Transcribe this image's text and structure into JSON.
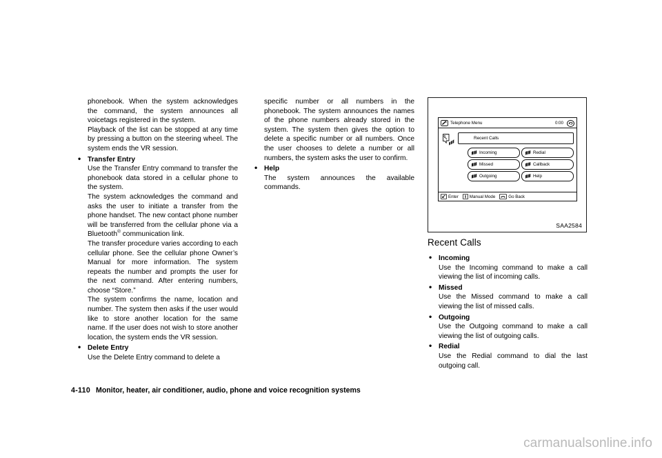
{
  "document": {
    "footer": {
      "page_number": "4-110",
      "chapter_title": "Monitor, heater, air conditioner, audio, phone and voice recognition systems"
    },
    "watermark": "carmanualsonline.info"
  },
  "column1": {
    "p1": "phonebook. When the system acknowledges the command, the system announces all voicetags registered in the system.",
    "p2": "Playback of the list can be stopped at any time by pressing a button on the steering wheel. The system ends the VR session.",
    "transfer_entry": {
      "heading": "Transfer Entry",
      "bullet": "•",
      "p1": "Use the Transfer Entry command to transfer the phonebook data stored in a cellular phone to the system.",
      "p2_before_sup": "The system acknowledges the command and asks the user to initiate a transfer from the phone handset. The new contact phone number will be transferred from the cellular phone via a Bluetooth",
      "p2_sup": "®",
      "p2_after_sup": " communication link.",
      "p3": "The transfer procedure varies according to each cellular phone. See the cellular phone Owner’s Manual for more information. The system repeats the number and prompts the user for the next command. After entering numbers, choose “Store.”",
      "p4": "The system confirms the name, location and number. The system then asks if the user would like to store another location for the same name. If the user does not wish to store another location, the system ends the VR session."
    },
    "delete_entry": {
      "heading": "Delete Entry",
      "bullet": "•",
      "p1": "Use the Delete Entry command to delete a"
    }
  },
  "column2": {
    "p1": "specific number or all numbers in the phonebook. The system announces the names of the phone numbers already stored in the system. The system then gives the option to delete a specific number or all numbers. Once the user chooses to delete a number or all numbers, the system asks the user to confirm.",
    "help": {
      "heading": "Help",
      "bullet": "•",
      "p1": "The system announces the available commands."
    }
  },
  "figure": {
    "code": "SAA2584",
    "screen": {
      "titlebar": {
        "icon": "phone-handset-icon",
        "title": "Telephone Menu",
        "clock": "0:00",
        "back_icon": "back-arrow-icon"
      },
      "voice_icon": "speaking-head-icon",
      "header_field": "Recent Calls",
      "buttons": [
        {
          "label": "Incoming",
          "icon": "voice-wave-icon"
        },
        {
          "label": "Redial",
          "icon": "voice-wave-icon"
        },
        {
          "label": "Missed",
          "icon": "voice-wave-icon"
        },
        {
          "label": "Callback",
          "icon": "voice-wave-icon"
        },
        {
          "label": "Outgoing",
          "icon": "voice-wave-icon"
        },
        {
          "label": "Help",
          "icon": "voice-wave-icon"
        }
      ],
      "footer": [
        {
          "label": "Enter",
          "icon": "enter-key-icon"
        },
        {
          "label": "Manual Mode",
          "icon": "joystick-icon"
        },
        {
          "label": "Go Back",
          "icon": "hang-up-icon"
        }
      ]
    }
  },
  "column3": {
    "section_title": "Recent Calls",
    "items": [
      {
        "bullet": "•",
        "heading": "Incoming",
        "body": "Use the Incoming command to make a call viewing the list of incoming calls."
      },
      {
        "bullet": "•",
        "heading": "Missed",
        "body": "Use the Missed command to make a call viewing the list of missed calls."
      },
      {
        "bullet": "•",
        "heading": "Outgoing",
        "body": "Use the Outgoing command to make a call viewing the list of outgoing calls."
      },
      {
        "bullet": "•",
        "heading": "Redial",
        "body": "Use the Redial command to dial the last outgoing call."
      }
    ]
  }
}
